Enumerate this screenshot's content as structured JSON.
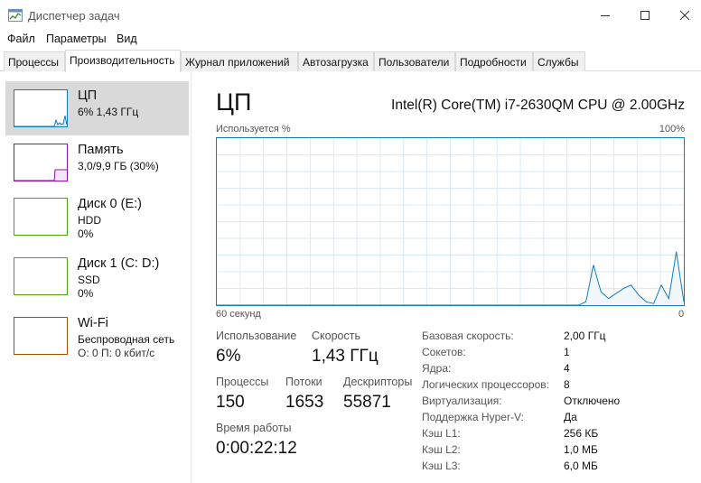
{
  "window": {
    "title": "Диспетчер задач",
    "min_icon": "minimize-icon",
    "max_icon": "maximize-icon",
    "close_icon": "close-icon"
  },
  "menu": [
    "Файл",
    "Параметры",
    "Вид"
  ],
  "tabs": [
    "Процессы",
    "Производительность",
    "Журнал приложений",
    "Автозагрузка",
    "Пользователи",
    "Подробности",
    "Службы"
  ],
  "active_tab": "Производительность",
  "resources": [
    {
      "name": "ЦП",
      "lines": [
        "6% 1,43 ГГц"
      ],
      "color": "#117dbb"
    },
    {
      "name": "Память",
      "lines": [
        "3,0/9,9 ГБ (30%)"
      ],
      "color": "#8b12ae"
    },
    {
      "name": "Диск 0 (E:)",
      "lines": [
        "HDD",
        "0%"
      ],
      "color": "#4da60c"
    },
    {
      "name": "Диск 1 (C: D:)",
      "lines": [
        "SSD",
        "0%"
      ],
      "color": "#4da60c"
    },
    {
      "name": "Wi-Fi",
      "lines": [
        "Беспроводная сеть",
        "О: 0 П: 0 кбит/с"
      ],
      "color": "#a74f01"
    }
  ],
  "main": {
    "title": "ЦП",
    "cpu_model": "Intel(R) Core(TM) i7-2630QM CPU @ 2.00GHz",
    "graph_top_left": "Используется %",
    "graph_top_right": "100%",
    "graph_bottom_left": "60 секунд",
    "graph_bottom_right": "0"
  },
  "stats": {
    "usage_label": "Использование",
    "usage_value": "6%",
    "speed_label": "Скорость",
    "speed_value": "1,43 ГГц",
    "processes_label": "Процессы",
    "processes_value": "150",
    "threads_label": "Потоки",
    "threads_value": "1653",
    "handles_label": "Дескрипторы",
    "handles_value": "55871",
    "uptime_label": "Время работы",
    "uptime_value": "0:00:22:12"
  },
  "details": [
    {
      "label": "Базовая скорость:",
      "value": "2,00 ГГц"
    },
    {
      "label": "Сокетов:",
      "value": "1"
    },
    {
      "label": "Ядра:",
      "value": "4"
    },
    {
      "label": "Логических процессоров:",
      "value": "8"
    },
    {
      "label": "Виртуализация:",
      "value": "Отключено"
    },
    {
      "label": "Поддержка Hyper-V:",
      "value": "Да"
    },
    {
      "label": "Кэш L1:",
      "value": "256 КБ"
    },
    {
      "label": "Кэш L2:",
      "value": "1,0 МБ"
    },
    {
      "label": "Кэш L3:",
      "value": "6,0 МБ"
    }
  ],
  "chart_data": {
    "type": "area",
    "ylim": [
      0,
      100
    ],
    "x_span_seconds": 60,
    "series": [
      {
        "values": [
          0,
          0,
          0,
          0,
          0,
          0,
          0,
          0,
          0,
          0,
          0,
          0,
          0,
          0,
          0,
          0,
          0,
          0,
          0,
          0,
          0,
          0,
          0,
          0,
          0,
          0,
          0,
          0,
          0,
          0,
          0,
          0,
          0,
          0,
          0,
          0,
          0,
          0,
          0,
          0,
          0,
          0,
          0,
          0,
          0,
          0,
          0,
          0,
          0,
          2,
          24,
          8,
          4,
          7,
          10,
          12,
          6,
          2,
          1,
          12,
          4,
          32,
          2
        ]
      }
    ]
  }
}
